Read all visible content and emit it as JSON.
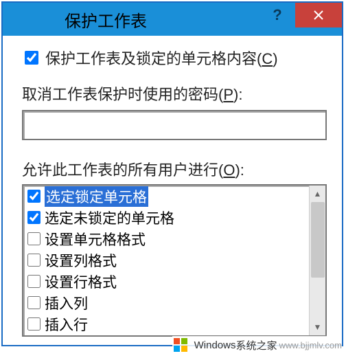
{
  "title": "保护工作表",
  "protect": {
    "checked": true,
    "label_prefix": "保护工作表及锁定的单元格内容(",
    "accel": "C",
    "label_suffix": ")"
  },
  "password": {
    "label_prefix": "取消工作表保护时使用的密码(",
    "accel": "P",
    "label_suffix": "):",
    "value": ""
  },
  "allow": {
    "label_prefix": "允许此工作表的所有用户进行(",
    "accel": "O",
    "label_suffix": "):"
  },
  "permissions": [
    {
      "checked": true,
      "label": "选定锁定单元格",
      "selected": true
    },
    {
      "checked": true,
      "label": "选定未锁定的单元格",
      "selected": false
    },
    {
      "checked": false,
      "label": "设置单元格格式",
      "selected": false
    },
    {
      "checked": false,
      "label": "设置列格式",
      "selected": false
    },
    {
      "checked": false,
      "label": "设置行格式",
      "selected": false
    },
    {
      "checked": false,
      "label": "插入列",
      "selected": false
    },
    {
      "checked": false,
      "label": "插入行",
      "selected": false
    }
  ],
  "watermark": {
    "brand": "Windows",
    "sub1": "系统之家",
    "sub2": "www.bjjmlv.com"
  }
}
